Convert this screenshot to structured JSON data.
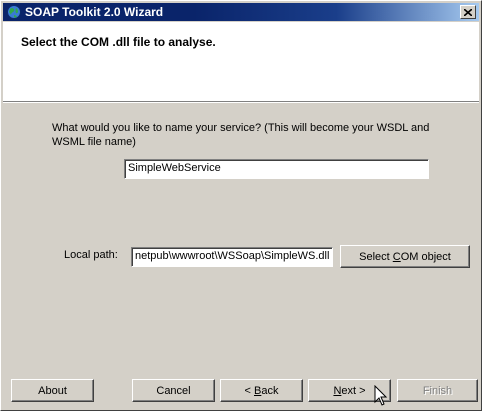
{
  "window": {
    "title": "SOAP Toolkit 2.0 Wizard",
    "close_label": "X"
  },
  "header": {
    "instruction": "Select the COM .dll file to analyse."
  },
  "form": {
    "service_prompt": "What would you like to name your service? (This will become your WSDL and WSML file name)",
    "service_name_value": "SimpleWebService",
    "local_path_label": "Local path:",
    "local_path_value": "netpub\\wwwroot\\WSSoap\\SimpleWS.dll",
    "select_com_button_pre": "Select ",
    "select_com_button_mnemonic": "C",
    "select_com_button_post": "OM object"
  },
  "footer": {
    "about_label": "About",
    "cancel_label": "Cancel",
    "back_prefix": "< ",
    "back_mnemonic": "B",
    "back_rest": "ack",
    "next_mnemonic": "N",
    "next_rest": "ext >",
    "finish_label": "Finish"
  }
}
